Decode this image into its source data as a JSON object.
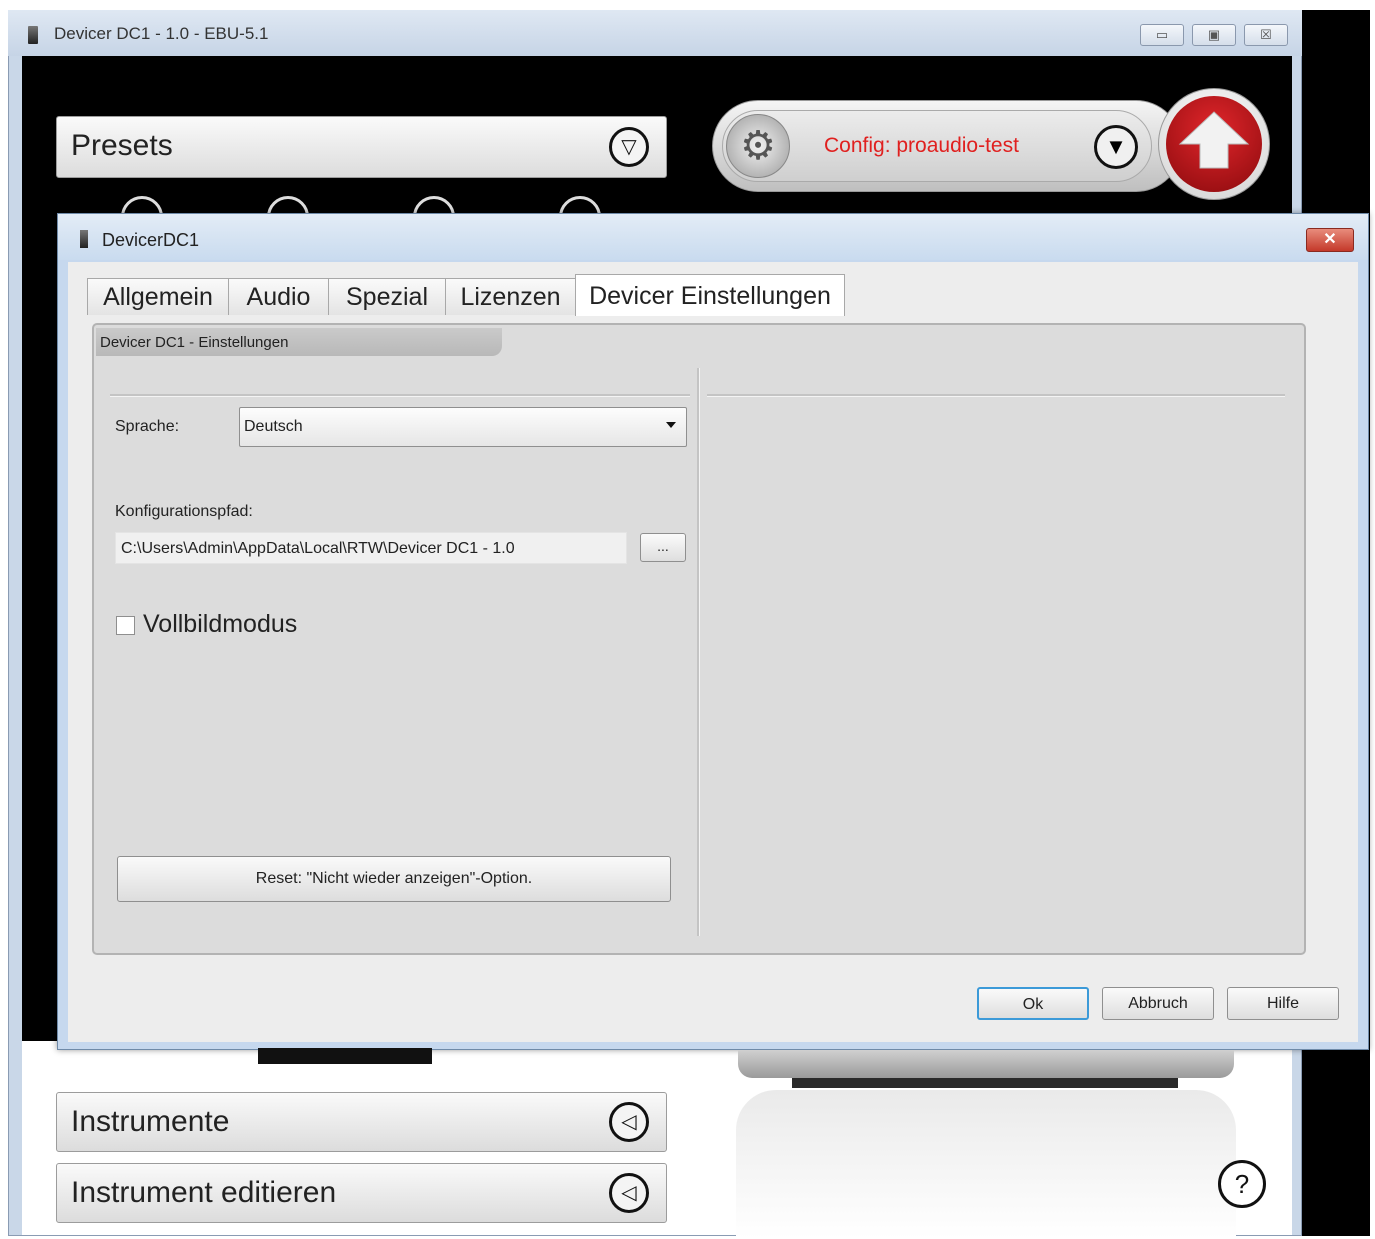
{
  "main_window": {
    "title": "Devicer DC1 - 1.0 - EBU-5.1",
    "controls": {
      "minimize": "▭",
      "maximize": "▣",
      "close": "☒"
    }
  },
  "presets": {
    "label": "Presets",
    "arrow": "▽"
  },
  "config": {
    "label": "Config: proaudio-test",
    "gear": "⚙",
    "arrow": "▼"
  },
  "dialog": {
    "title": "DevicerDC1",
    "close": "✕",
    "tabs": [
      "Allgemein",
      "Audio",
      "Spezial",
      "Lizenzen",
      "Devicer Einstellungen"
    ],
    "active_tab": "Devicer Einstellungen",
    "group_title": "Devicer DC1 - Einstellungen",
    "sprache": {
      "label": "Sprache:",
      "value": "Deutsch"
    },
    "konfigurationspfad": {
      "label": "Konfigurationspfad:",
      "value": "C:\\Users\\Admin\\AppData\\Local\\RTW\\Devicer DC1 - 1.0",
      "browse": "..."
    },
    "vollbildmodus": {
      "label": "Vollbildmodus",
      "checked": false
    },
    "reset_button": "Reset: \"Nicht wieder anzeigen\"-Option.",
    "buttons": {
      "ok": "Ok",
      "cancel": "Abbruch",
      "help": "Hilfe"
    }
  },
  "lower": {
    "instrumente": {
      "label": "Instrumente",
      "arrow": "◁"
    },
    "instrument_editieren": {
      "label": "Instrument editieren",
      "arrow": "◁"
    },
    "help_icon": "?"
  },
  "colors": {
    "config_text": "#e0201f",
    "upload_button": "#c3161b",
    "ok_focus": "#3c9ad8"
  }
}
